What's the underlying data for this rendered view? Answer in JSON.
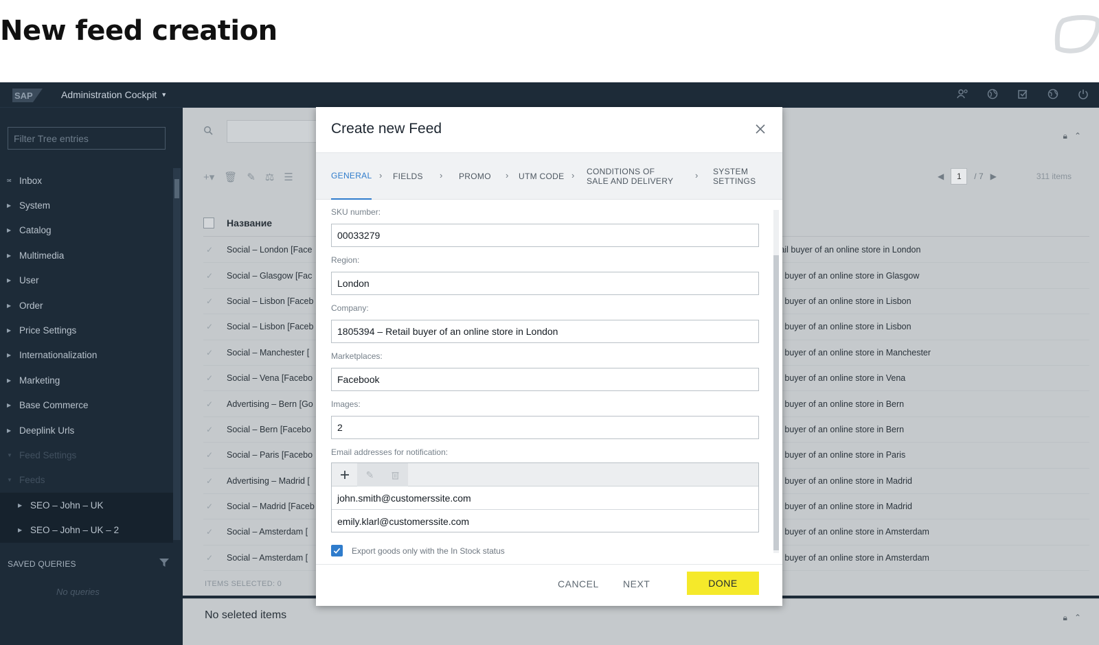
{
  "heading": "New feed creation",
  "app": {
    "brand": "SAP",
    "title": "Administration Cockpit",
    "top_icons": [
      "user-settings-icon",
      "globe-icon",
      "tasks-icon",
      "language-icon",
      "power-icon"
    ]
  },
  "sidebar": {
    "filter_placeholder": "Filter Tree entries",
    "items": [
      {
        "label": "Inbox",
        "icon": "inbox-icon"
      },
      {
        "label": "System"
      },
      {
        "label": "Catalog"
      },
      {
        "label": "Multimedia"
      },
      {
        "label": "User"
      },
      {
        "label": "Order"
      },
      {
        "label": "Price Settings"
      },
      {
        "label": "Internationalization"
      },
      {
        "label": "Marketing"
      },
      {
        "label": "Base Commerce"
      },
      {
        "label": "Deeplink Urls"
      },
      {
        "label": "Feed Settings"
      },
      {
        "label": "Feeds"
      },
      {
        "label": "SEO – John – UK"
      },
      {
        "label": "SEO – John – UK – 2"
      }
    ],
    "saved_queries": "SAVED QUERIES",
    "no_queries": "No queries"
  },
  "content": {
    "column_name": "Название",
    "page": "1",
    "page_total": "/ 7",
    "items_count": "311 items",
    "items_selected": "ITEMS SELECTED: 0",
    "rows": [
      {
        "name": "Social – London [Face",
        "desc": "Retail buyer of an online store in London"
      },
      {
        "name": "Social – Glasgow [Fac",
        "desc": "etail buyer of an online store in Glasgow"
      },
      {
        "name": "Social – Lisbon [Faceb",
        "desc": "etail buyer of an online store in Lisbon"
      },
      {
        "name": "Social – Lisbon [Faceb",
        "desc": "etail buyer of an online store in Lisbon"
      },
      {
        "name": "Social – Manchester [",
        "desc": "etail buyer of an online store in Manchester"
      },
      {
        "name": "Social – Vena [Facebo",
        "desc": "etail buyer of an online store in Vena"
      },
      {
        "name": "Advertising – Bern [Go",
        "desc": "etail buyer of an online store in Bern"
      },
      {
        "name": "Social –  Bern [Facebo",
        "desc": "etail buyer of an online store in Bern"
      },
      {
        "name": "Social – Paris [Facebo",
        "desc": "etail buyer of an online store in Paris"
      },
      {
        "name": "Advertising –  Madrid [",
        "desc": "etail buyer of an online store in Madrid"
      },
      {
        "name": "Social – Madrid [Faceb",
        "desc": "etail buyer of an online store in Madrid"
      },
      {
        "name": "Social – Amsterdam [",
        "desc": "etail buyer of an online store in Amsterdam"
      },
      {
        "name": "Social – Amsterdam [",
        "desc": "etail buyer of an online store in Amsterdam"
      }
    ],
    "no_selected": "No seleted items"
  },
  "modal": {
    "title": "Create new Feed",
    "steps": [
      {
        "label": "GENERAL",
        "active": true
      },
      {
        "label": "FIELDS"
      },
      {
        "label": "PROMO"
      },
      {
        "label": "UTM CODE"
      },
      {
        "label": "CONDITIONS OF SALE AND DELIVERY"
      },
      {
        "label": "SYSTEM SETTINGS"
      }
    ],
    "fields": {
      "sku_label": "SKU number:",
      "sku_value": "00033279",
      "region_label": "Region:",
      "region_value": "London",
      "company_label": "Company:",
      "company_value": "1805394 – Retail buyer of an online store in London",
      "marketplaces_label": "Marketplaces:",
      "marketplaces_value": "Facebook",
      "images_label": "Images:",
      "images_value": "2",
      "emails_label": "Email addresses for notification:",
      "emails": [
        "john.smith@customerssite.com",
        "emily.klarl@customerssite.com"
      ]
    },
    "stock_checkbox": {
      "label": "Export goods only with the In Stock status",
      "checked": true
    },
    "cancel": "CANCEL",
    "next": "NEXT",
    "done": "DONE"
  },
  "colors": {
    "accent": "#2f7ccc",
    "done_button": "#f5e92a",
    "shell": "#1d2b38"
  }
}
